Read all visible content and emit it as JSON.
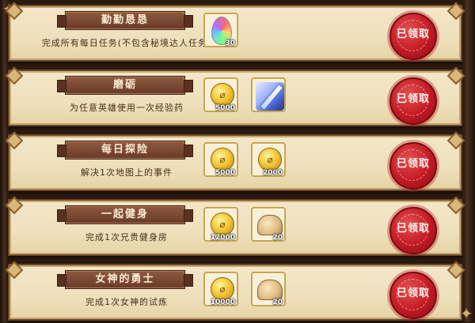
{
  "quests": [
    {
      "title": "勤勤恳恳",
      "description": "完成所有每日任务(不包含秘境达人任务)",
      "rewards": [
        {
          "icon": "rainbow-gem-icon",
          "quantity": "30"
        }
      ],
      "status": "已领取"
    },
    {
      "title": "磨砺",
      "description": "为任意英雄使用一次经验药",
      "rewards": [
        {
          "icon": "gold-coin-icon",
          "quantity": "5000"
        },
        {
          "icon": "blue-sword-icon",
          "quantity": ""
        }
      ],
      "status": "已领取"
    },
    {
      "title": "每日探险",
      "description": "解决1次地图上的事件",
      "rewards": [
        {
          "icon": "gold-coin-icon",
          "quantity": "5000"
        },
        {
          "icon": "gold-coin-icon",
          "quantity": "2000"
        }
      ],
      "status": "已领取"
    },
    {
      "title": "一起健身",
      "description": "完成1次兄贵健身房",
      "rewards": [
        {
          "icon": "gold-coin-icon",
          "quantity": "12000"
        },
        {
          "icon": "bread-icon",
          "quantity": "20"
        }
      ],
      "status": "已领取"
    },
    {
      "title": "女神的勇士",
      "description": "完成1次女神的试炼",
      "rewards": [
        {
          "icon": "gold-coin-icon",
          "quantity": "10000"
        },
        {
          "icon": "bread-icon",
          "quantity": "20"
        }
      ],
      "status": "已领取"
    }
  ],
  "colors": {
    "banner": "#7a4632",
    "seal": "#c21a24",
    "card": "#efe0bc"
  }
}
